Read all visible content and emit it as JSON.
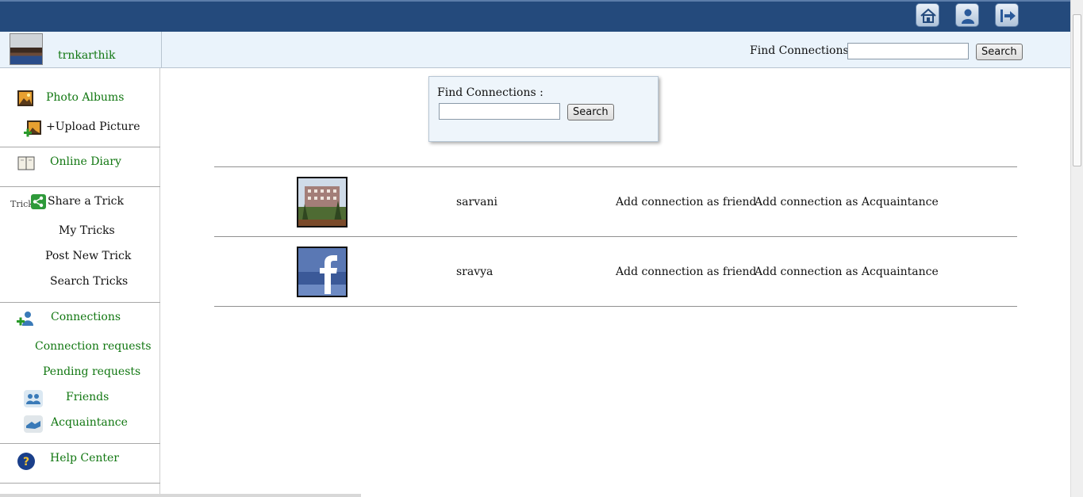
{
  "header": {
    "icons": [
      "home-icon",
      "profile-icon",
      "logout-icon"
    ]
  },
  "user": {
    "name": "trnkarthik"
  },
  "top_search": {
    "label": "Find Connections :",
    "value": "",
    "button": "Search"
  },
  "sidebar": {
    "photo_albums": "Photo Albums",
    "upload_picture": "+Upload Picture",
    "online_diary": "Online Diary",
    "trick_badge": "Trick",
    "share_trick": "Share a Trick",
    "my_tricks": "My Tricks",
    "post_new_trick": "Post New Trick",
    "search_tricks": "Search Tricks",
    "connections": "Connections",
    "connection_requests": "Connection requests",
    "pending_requests": "Pending requests",
    "friends": "Friends",
    "acquaintance": "Acquaintance",
    "help_center": "Help Center"
  },
  "main_search": {
    "label": "Find Connections :",
    "value": "",
    "button": "Search"
  },
  "results": [
    {
      "name": "sarvani",
      "add_friend": "Add connection as friend",
      "add_acquaintance": "Add connection as Acquaintance"
    },
    {
      "name": "sravya",
      "add_friend": "Add connection as friend",
      "add_acquaintance": "Add connection as Acquaintance"
    }
  ],
  "colors": {
    "topbar": "#244a7c",
    "link_green": "#117711",
    "subbar": "#eaf3fb"
  }
}
